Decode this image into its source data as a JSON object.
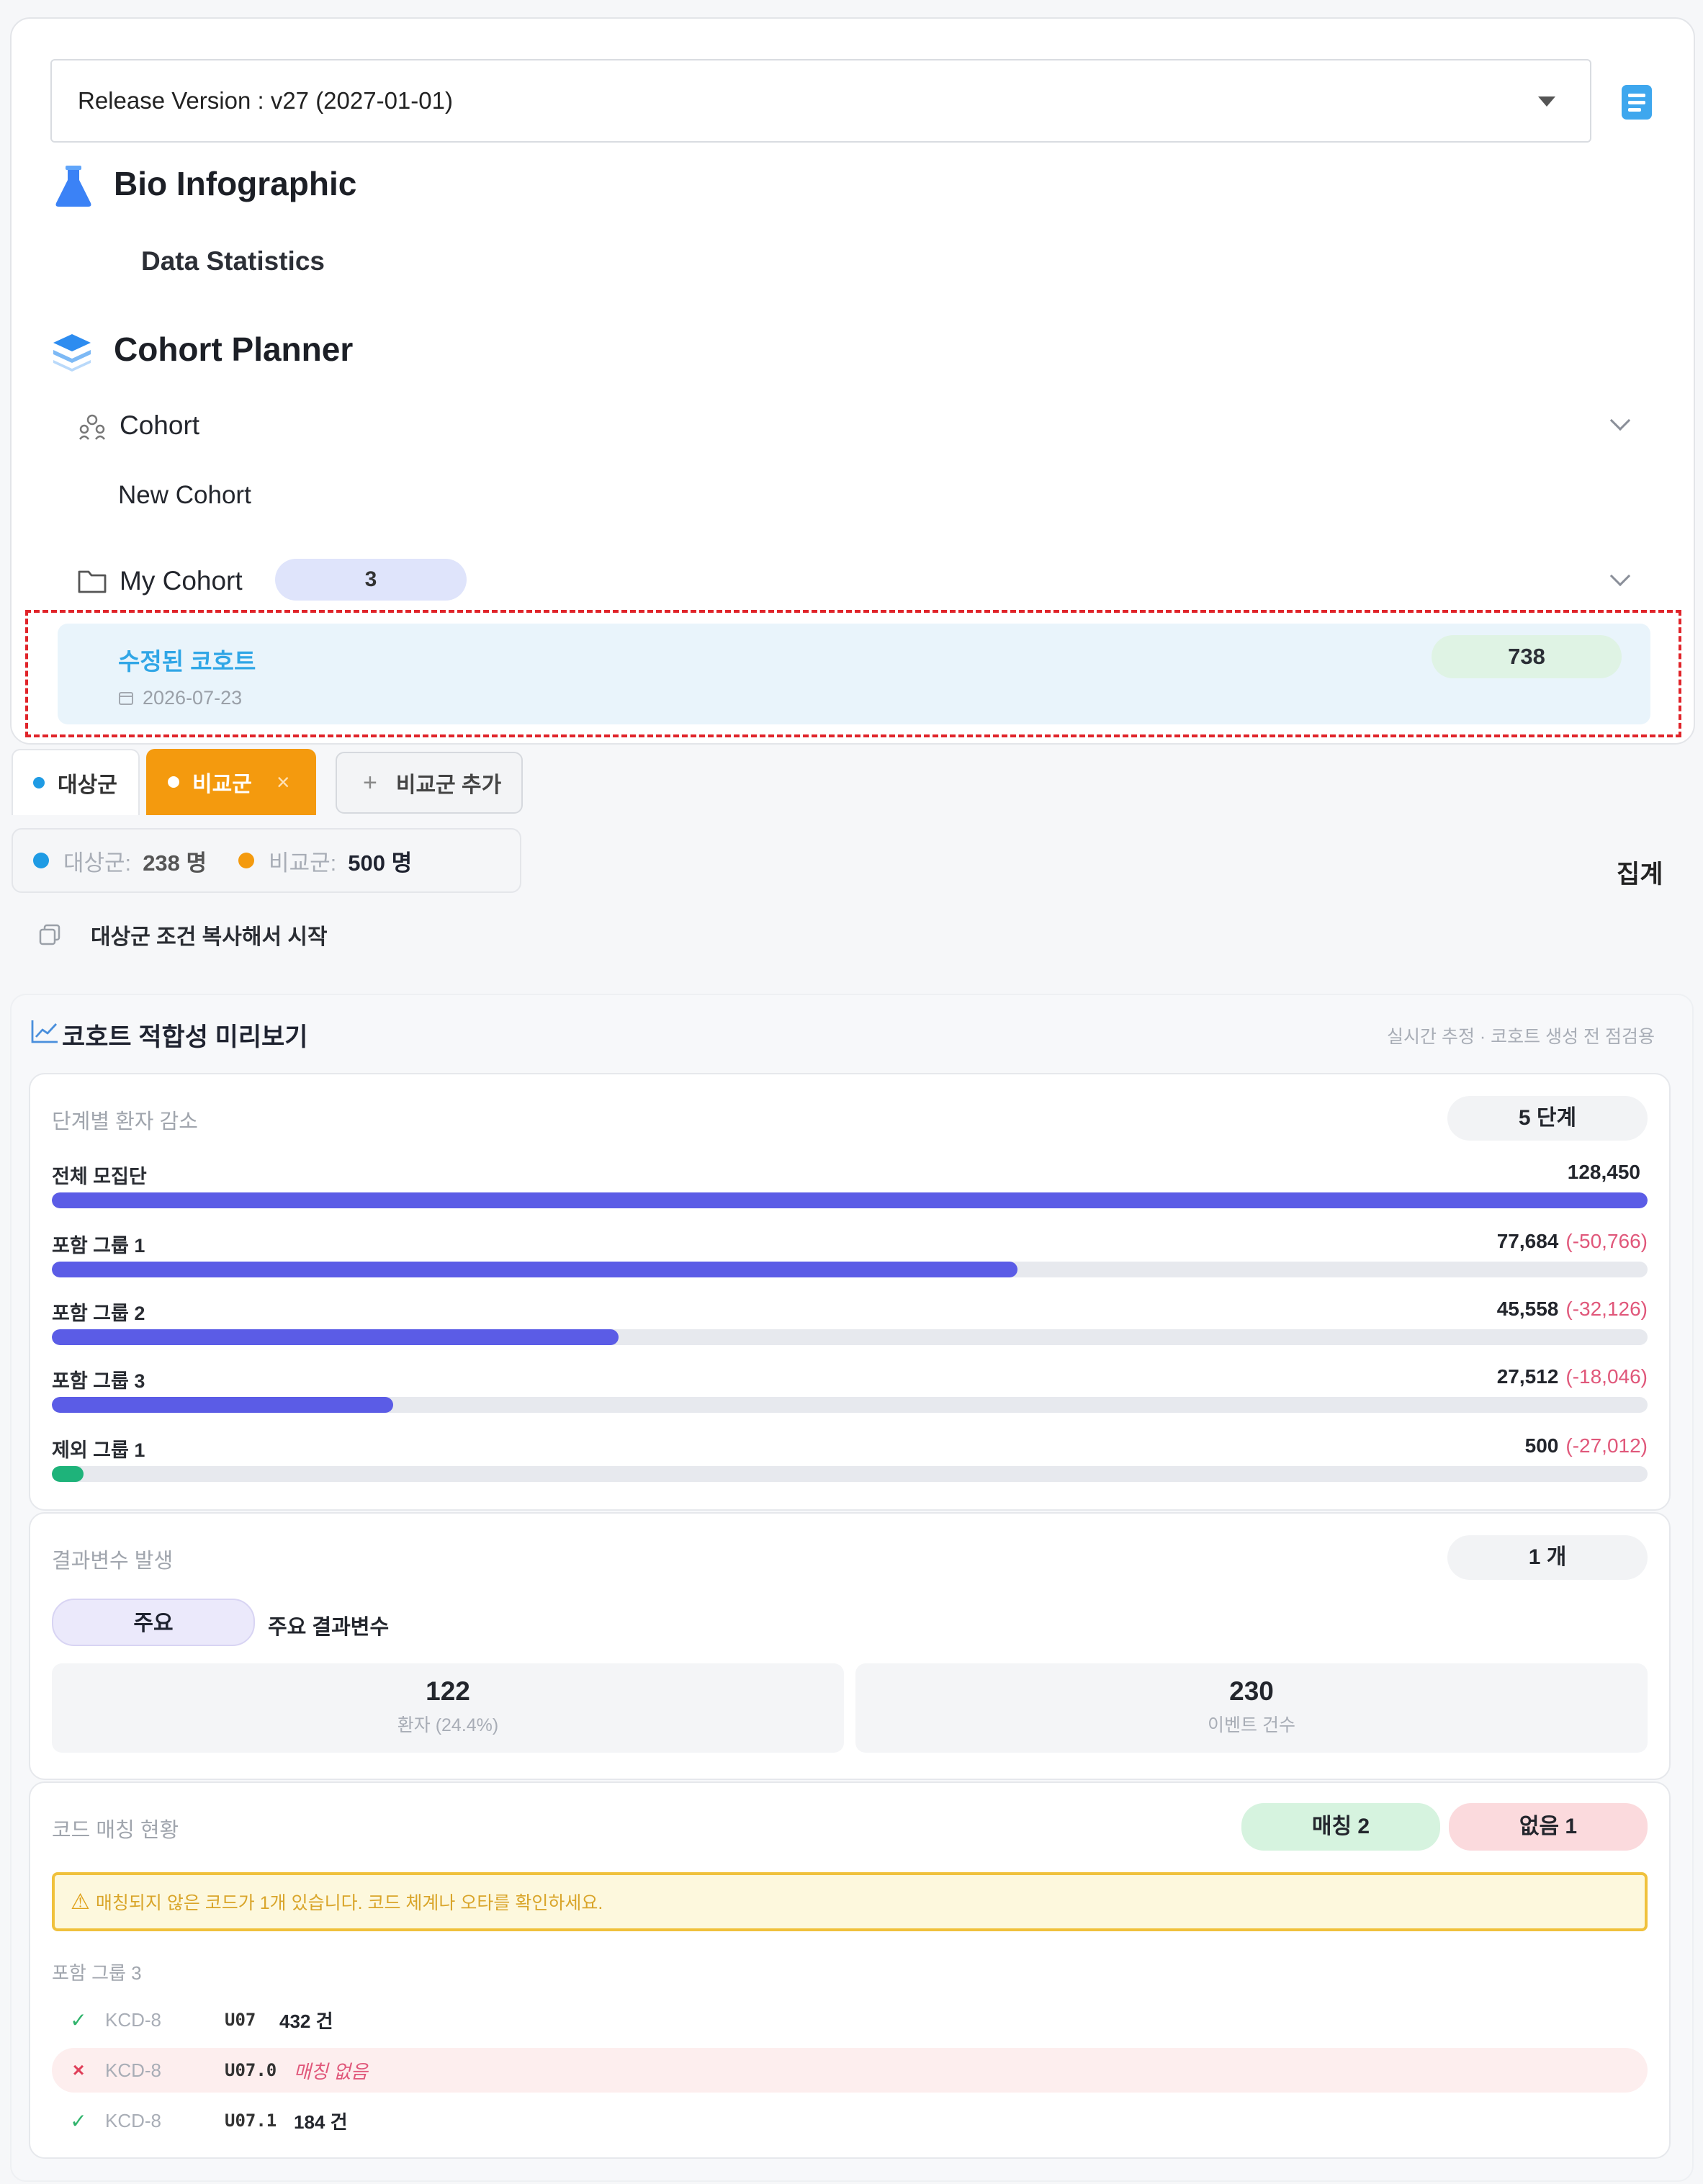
{
  "sidebar": {
    "release_select": "Release Version : v27 (2027-01-01)",
    "bio_title": "Bio Infographic",
    "data_statistics": "Data Statistics",
    "cohort_planner_title": "Cohort Planner",
    "cohort_menu": "Cohort",
    "new_cohort": "New Cohort",
    "my_cohort": "My Cohort",
    "my_cohort_count": "3",
    "cohort_item": {
      "name": "수정된 코호트",
      "date": "2026-07-23",
      "count": "738"
    }
  },
  "tabs": {
    "target": "대상군",
    "compare": "비교군",
    "close": "×",
    "add": "비교군 추가"
  },
  "counts": {
    "target_label": "대상군:",
    "target_value": "238 명",
    "compare_label": "비교군:",
    "compare_value": "500 명",
    "aggregate": "집계"
  },
  "copy_conditions": "대상군 조건 복사해서 시작",
  "preview": {
    "title": "코호트 적합성 미리보기",
    "note": "실시간 추정 · 코호트 생성 전 점검용",
    "funnel": {
      "label": "단계별 환자 감소",
      "steps_chip": "5 단계",
      "rows": [
        {
          "label": "전체 모집단",
          "value": "128,450",
          "delta": "",
          "fraction": 1.0,
          "color": "#5b5ce6"
        },
        {
          "label": "포함 그룹 1",
          "value": "77,684",
          "delta": "(-50,766)",
          "fraction": 0.605,
          "color": "#5b5ce6"
        },
        {
          "label": "포함 그룹 2",
          "value": "45,558",
          "delta": "(-32,126)",
          "fraction": 0.355,
          "color": "#5b5ce6"
        },
        {
          "label": "포함 그룹 3",
          "value": "27,512",
          "delta": "(-18,046)",
          "fraction": 0.214,
          "color": "#5b5ce6"
        },
        {
          "label": "제외 그룹 1",
          "value": "500",
          "delta": "(-27,012)",
          "fraction": 0.02,
          "color": "#1eb37a"
        }
      ]
    },
    "outcome": {
      "label": "결과변수 발생",
      "count_chip": "1 개",
      "tag": "주요",
      "tag_label": "주요 결과변수",
      "patients_value": "122",
      "patients_label": "환자 (24.4%)",
      "events_value": "230",
      "events_label": "이벤트 건수"
    },
    "codes": {
      "label": "코드 매칭 현황",
      "matched_chip": "매칭 2",
      "missing_chip": "없음 1",
      "warning": "매칭되지 않은 코드가 1개 있습니다. 코드 체계나 오타를 확인하세요.",
      "group_label": "포함 그룹 3",
      "rows": [
        {
          "mark": "✓",
          "system": "KCD-8",
          "code": "U07",
          "result": "432 건",
          "matched": true
        },
        {
          "mark": "×",
          "system": "KCD-8",
          "code": "U07.0",
          "result": "매칭 없음",
          "matched": false
        },
        {
          "mark": "✓",
          "system": "KCD-8",
          "code": "U07.1",
          "result": "184 건",
          "matched": true
        }
      ]
    }
  }
}
